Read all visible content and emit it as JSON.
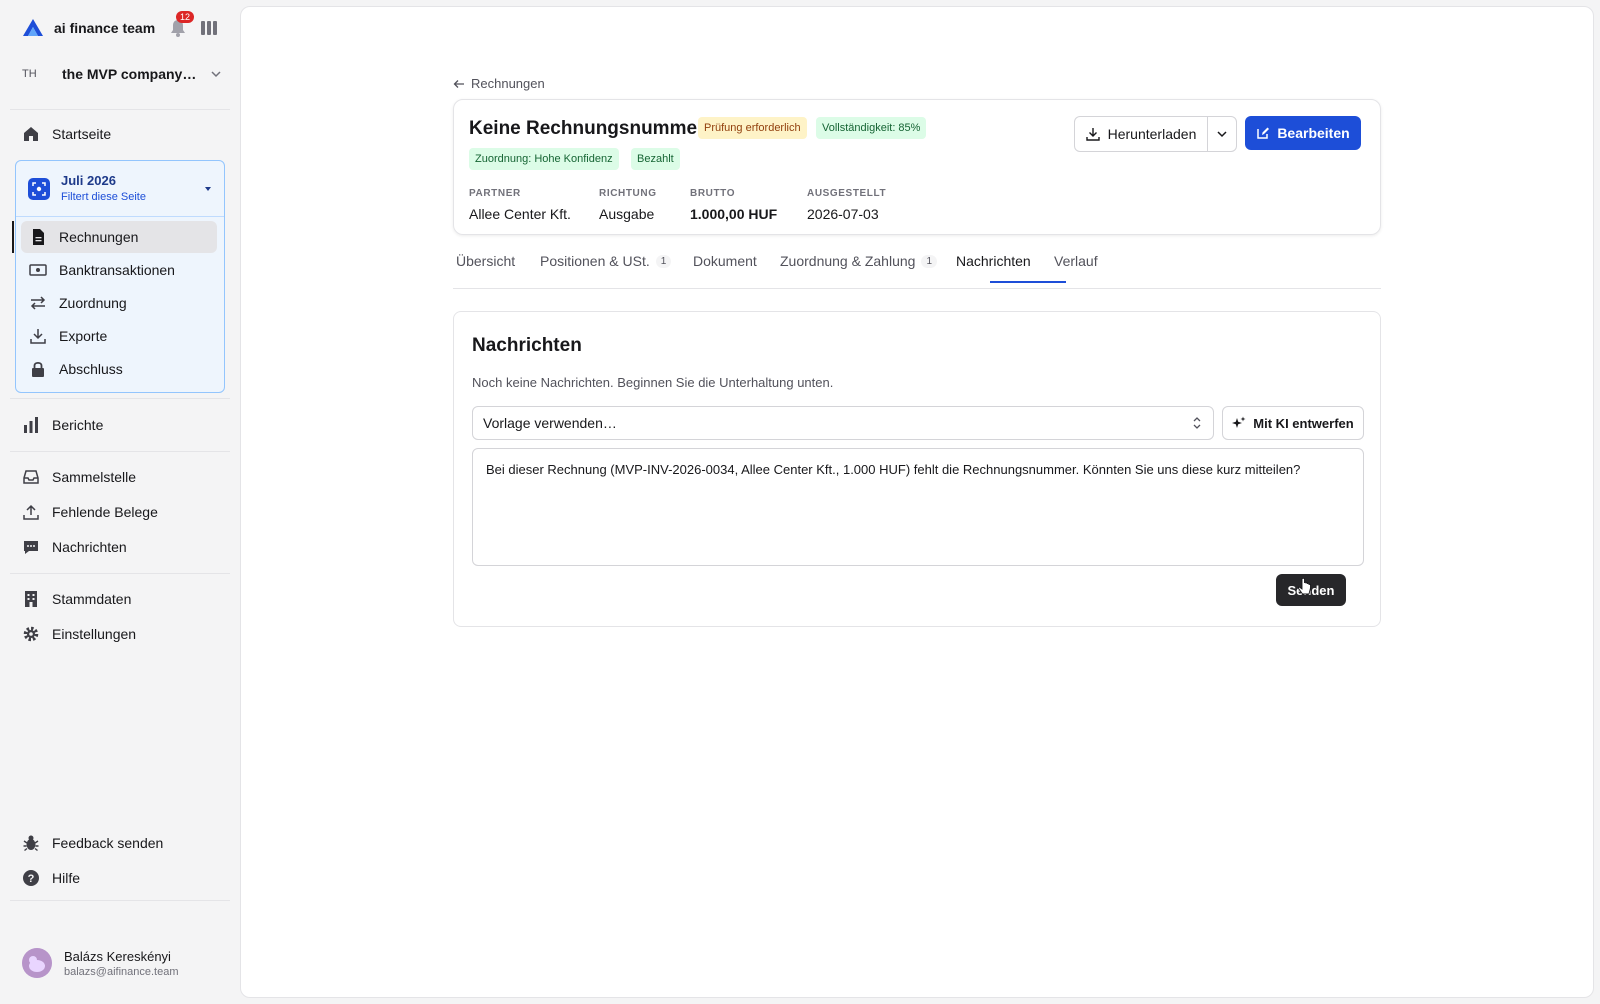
{
  "app": {
    "brand_name": "ai finance team",
    "notification_count": "12",
    "company_initials": "TH",
    "company_name": "the MVP company…"
  },
  "sidebar": {
    "home": "Startseite",
    "period": {
      "title": "Juli 2026",
      "subtitle": "Filtert diese Seite",
      "items": [
        "Rechnungen",
        "Banktransaktionen",
        "Zuordnung",
        "Exporte",
        "Abschluss"
      ]
    },
    "reports": "Berichte",
    "group2": [
      "Sammelstelle",
      "Fehlende Belege",
      "Nachrichten"
    ],
    "group3": [
      "Stammdaten",
      "Einstellungen"
    ],
    "feedback": "Feedback senden",
    "help": "Hilfe",
    "user": {
      "name": "Balázs Kereskényi",
      "email": "balazs@aifinance.team"
    }
  },
  "invoice": {
    "back_label": "Rechnungen",
    "title": "Keine Rechnungsnummer",
    "badges": {
      "review": "Prüfung erforderlich",
      "completeness": "Vollständigkeit: 85%",
      "match": "Zuordnung: Hohe Konfidenz",
      "paid": "Bezahlt"
    },
    "meta": {
      "partner_label": "PARTNER",
      "partner_value": "Allee Center Kft.",
      "direction_label": "RICHTUNG",
      "direction_value": "Ausgabe",
      "gross_label": "BRUTTO",
      "gross_value": "1.000,00 HUF",
      "issued_label": "AUSGESTELLT",
      "issued_value": "2026-07-03"
    },
    "download_label": "Herunterladen",
    "edit_label": "Bearbeiten"
  },
  "tabs": {
    "overview": "Übersicht",
    "positions": "Positionen & USt.",
    "positions_count": "1",
    "document": "Dokument",
    "matching": "Zuordnung & Zahlung",
    "matching_count": "1",
    "messages": "Nachrichten",
    "history": "Verlauf"
  },
  "messages": {
    "title": "Nachrichten",
    "empty_text": "Noch keine Nachrichten. Beginnen Sie die Unterhaltung unten.",
    "template_placeholder": "Vorlage verwenden…",
    "ai_draft_label": "Mit KI entwerfen",
    "draft_text": "Bei dieser Rechnung (MVP-INV-2026-0034, Allee Center Kft., 1.000 HUF) fehlt die Rechnungsnummer. Könnten Sie uns diese kurz mitteilen?",
    "send_label": "Senden"
  },
  "colors": {
    "accent": "#1d4ed8",
    "warn_bg": "#fef3c7",
    "success_bg": "#dcfce7"
  }
}
